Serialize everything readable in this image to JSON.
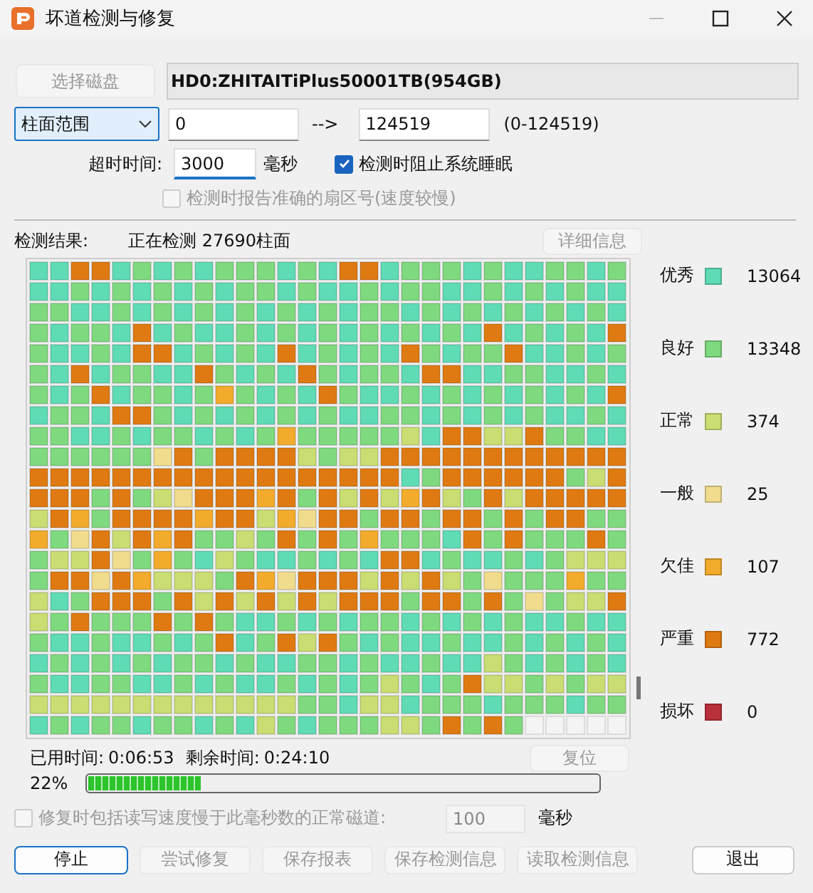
{
  "window": {
    "title": "坏道检测与修复"
  },
  "disk": {
    "button": "选择磁盘",
    "button_disabled": true,
    "name": "HD0:ZHITAITiPlus50001TB(954GB)"
  },
  "range": {
    "mode": "柱面范围",
    "from": "0",
    "arrow": "-->",
    "to": "124519",
    "hint": "(0-124519)"
  },
  "timeout": {
    "label": "超时时间:",
    "value": "3000",
    "unit": "毫秒"
  },
  "prevent_sleep": {
    "label": "检测时阻止系统睡眠",
    "checked": true,
    "disabled": false
  },
  "report_sector": {
    "label": "检测时报告准确的扇区号(速度较慢)",
    "checked": false,
    "disabled": true
  },
  "result": {
    "label": "检测结果:",
    "status": "正在检测 27690柱面",
    "details_button": "详细信息"
  },
  "legend": [
    {
      "label": "优秀",
      "color": "#5fdbb6",
      "count": "13064"
    },
    {
      "label": "良好",
      "color": "#7fd97f",
      "count": "13348"
    },
    {
      "label": "正常",
      "color": "#c9dd72",
      "count": "374"
    },
    {
      "label": "一般",
      "color": "#f0dc8c",
      "count": "25"
    },
    {
      "label": "欠佳",
      "color": "#f2ab2c",
      "count": "107"
    },
    {
      "label": "严重",
      "color": "#df7a12",
      "count": "772"
    },
    {
      "label": "损坏",
      "color": "#b7303a",
      "count": "0"
    }
  ],
  "time": {
    "elapsed_label": "已用时间:",
    "elapsed": "0:06:53",
    "remaining_label": "剩余时间:",
    "remaining": "0:24:10",
    "reset_button": "复位",
    "reset_disabled": true
  },
  "progress": {
    "percent": "22%",
    "level": 0.22
  },
  "repair_slow": {
    "label": "修复时包括读写速度慢于此毫秒数的正常磁道:",
    "checked": false,
    "disabled": true,
    "value": "100",
    "unit": "毫秒"
  },
  "buttons": [
    {
      "label": "停止",
      "disabled": false,
      "default": true
    },
    {
      "label": "尝试修复",
      "disabled": true,
      "default": false
    },
    {
      "label": "保存报表",
      "disabled": true,
      "default": false
    },
    {
      "label": "保存检测信息",
      "disabled": true,
      "default": false
    },
    {
      "label": "读取检测信息",
      "disabled": true,
      "default": false
    },
    {
      "label": "退出",
      "disabled": false,
      "default": false
    }
  ]
}
